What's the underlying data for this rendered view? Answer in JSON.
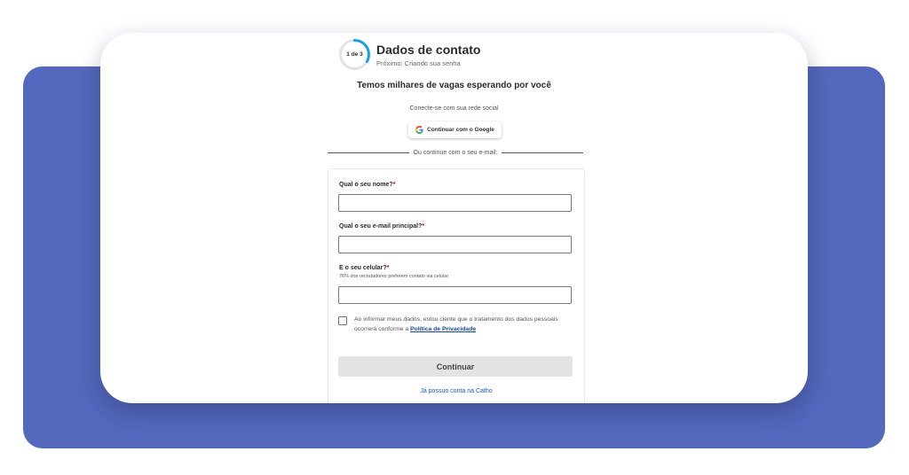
{
  "colors": {
    "background_panel": "#5468bd",
    "progress_accent": "#1aa0e6",
    "link": "#1d56c5",
    "required": "#d0021b",
    "button_disabled": "#e3e3e3"
  },
  "stepper": {
    "progress_label": "1 de 3",
    "progress_fraction": 0.333,
    "title": "Dados de contato",
    "next": "Próximo: Criando sua senha"
  },
  "headline": "Temos milhares de vagas esperando por você",
  "social": {
    "label": "Conecte-se com sua rede social",
    "google_button": "Continuar com o Google",
    "google_icon": "google-g-icon"
  },
  "divider_text": "Ou continue com o seu e-mail:",
  "form": {
    "name_label": "Qual o seu nome?",
    "email_label": "Qual o seu e-mail principal?",
    "phone_label": "E o seu celular?",
    "phone_helper": "76% dos recrutadores preferem contato via celular",
    "required_mark": "*",
    "name_value": "",
    "email_value": "",
    "phone_value": "",
    "consent_text": "Ao informar meus dados, estou ciente que o tratamento dos dados pessoais ocorrerá conforme a ",
    "consent_link": "Política de Privacidade",
    "consent_checked": false,
    "submit_label": "Continuar",
    "login_link": "Já possuo conta na Catho"
  }
}
